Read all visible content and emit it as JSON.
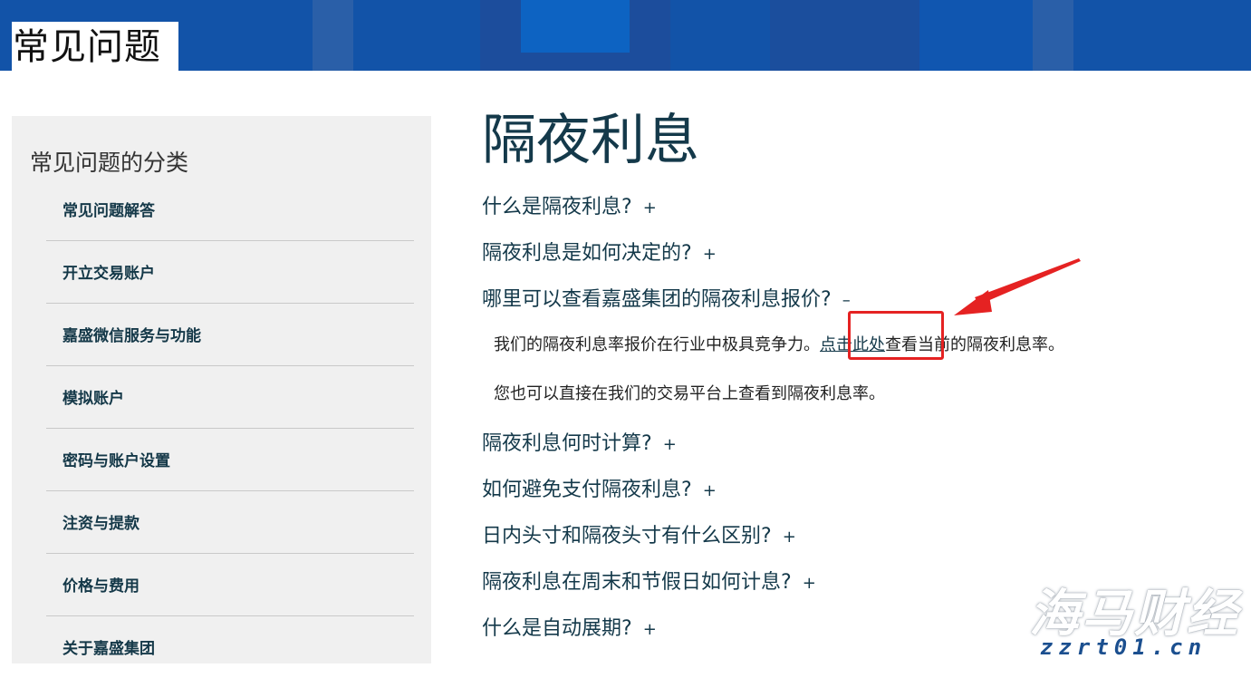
{
  "header": {
    "title": "常见问题"
  },
  "sidebar": {
    "heading": "常见问题的分类",
    "items": [
      {
        "label": "常见问题解答"
      },
      {
        "label": "开立交易账户"
      },
      {
        "label": "嘉盛微信服务与功能"
      },
      {
        "label": "模拟账户"
      },
      {
        "label": "密码与账户设置"
      },
      {
        "label": "注资与提款"
      },
      {
        "label": "价格与费用"
      },
      {
        "label": "关于嘉盛集团"
      }
    ]
  },
  "main": {
    "title": "隔夜利息",
    "questions": [
      {
        "text": "什么是隔夜利息?",
        "toggle": "+"
      },
      {
        "text": "隔夜利息是如何决定的?",
        "toggle": "+"
      },
      {
        "text": "哪里可以查看嘉盛集团的隔夜利息报价?",
        "toggle": "–"
      },
      {
        "text": "隔夜利息何时计算?",
        "toggle": "+"
      },
      {
        "text": "如何避免支付隔夜利息?",
        "toggle": "+"
      },
      {
        "text": "日内头寸和隔夜头寸有什么区别?",
        "toggle": "+"
      },
      {
        "text": "隔夜利息在周末和节假日如何计息?",
        "toggle": "+"
      },
      {
        "text": "什么是自动展期?",
        "toggle": "+"
      }
    ],
    "answer": {
      "p1_before": "我们的隔夜利息率报价在行业中极具竞争力。",
      "p1_link": "点击此处",
      "p1_after": "查看当前的隔夜利息率。",
      "p2": "您也可以直接在我们的交易平台上查看到隔夜利息率。"
    }
  },
  "watermark": {
    "logo": "海马财经",
    "url": "zzrt01.cn"
  },
  "colors": {
    "banner": "#1253a8",
    "annotation": "#e52222",
    "heading_text": "#14394a"
  }
}
